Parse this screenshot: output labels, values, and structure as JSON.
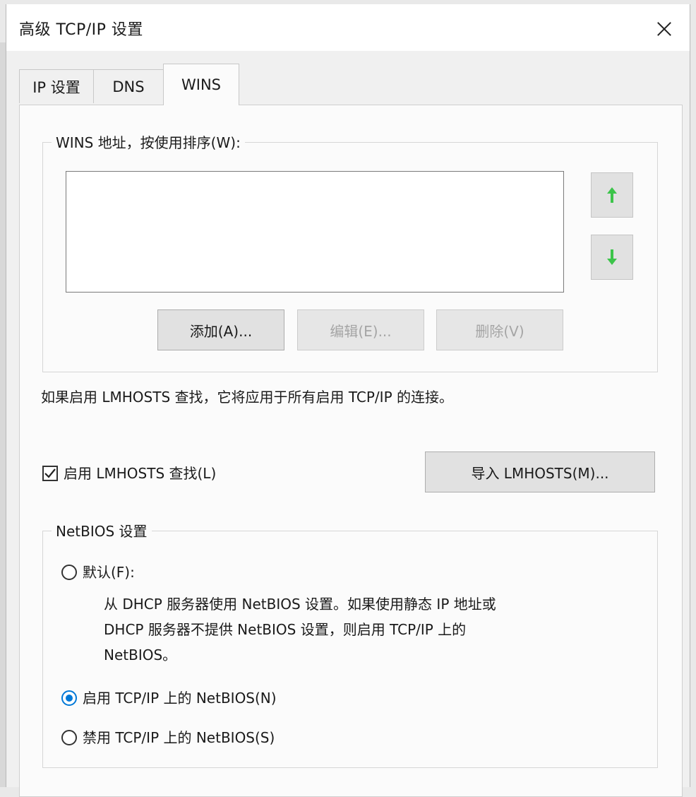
{
  "window": {
    "title": "高级 TCP/IP 设置"
  },
  "tabs": [
    {
      "label": "IP 设置",
      "active": false
    },
    {
      "label": "DNS",
      "active": false
    },
    {
      "label": "WINS",
      "active": true
    }
  ],
  "wins": {
    "group_label": "WINS 地址，按使用排序(W):",
    "addresses": [],
    "add_button": "添加(A)...",
    "edit_button": "编辑(E)...",
    "remove_button": "删除(V)",
    "move_up_icon": "arrow-up-icon",
    "move_down_icon": "arrow-down-icon"
  },
  "lmhosts": {
    "info_text": "如果启用 LMHOSTS 查找，它将应用于所有启用 TCP/IP 的连接。",
    "checkbox_label": "启用 LMHOSTS 查找(L)",
    "checkbox_checked": true,
    "import_button": "导入 LMHOSTS(M)..."
  },
  "netbios": {
    "group_label": "NetBIOS 设置",
    "options": [
      {
        "label": "默认(F):",
        "checked": false
      },
      {
        "label": "启用 TCP/IP 上的 NetBIOS(N)",
        "checked": true
      },
      {
        "label": "禁用 TCP/IP 上的 NetBIOS(S)",
        "checked": false
      }
    ],
    "default_description": [
      "从 DHCP 服务器使用 NetBIOS 设置。如果使用静态 IP 地址或",
      "DHCP 服务器不提供 NetBIOS 设置，则启用 TCP/IP 上的",
      "NetBIOS。"
    ]
  },
  "colors": {
    "accent": "#0078d7",
    "arrow_green": "#3cc44a"
  }
}
